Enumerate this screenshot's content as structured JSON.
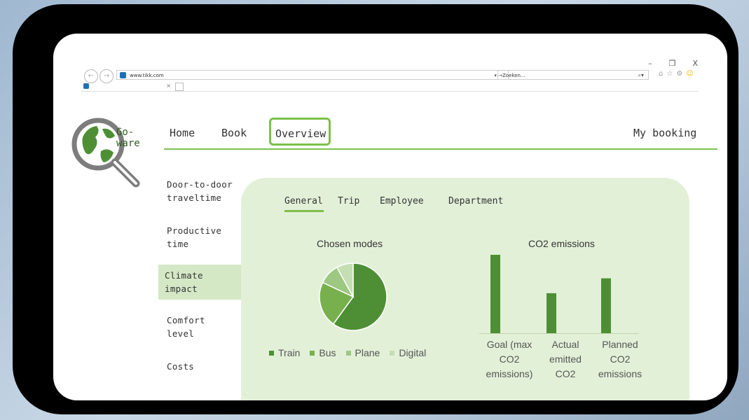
{
  "browser": {
    "url": "www.tikk.com",
    "search_placeholder": "Zoeken...",
    "tab_title": "",
    "window_controls": [
      "–",
      "❐",
      "X"
    ]
  },
  "app": {
    "logo_text": "Go-\nware",
    "nav": {
      "home": "Home",
      "book": "Book",
      "overview": "Overview",
      "my_booking": "My booking"
    },
    "sidebar": [
      {
        "label": "Door-to-door\ntraveltime"
      },
      {
        "label": "Productive\ntime"
      },
      {
        "label": "Climate\nimpact"
      },
      {
        "label": "Comfort\nlevel"
      },
      {
        "label": "Costs"
      }
    ],
    "subtabs": [
      "General",
      "Trip",
      "Employee",
      "Department"
    ]
  },
  "colors": {
    "accent_green": "#7cc04a",
    "panel_bg": "#e3f0d8",
    "train": "#4e8f35",
    "bus": "#78b04e",
    "plane": "#9dc882",
    "digital": "#c4dfb3"
  },
  "chart_data": [
    {
      "type": "pie",
      "title": "Chosen modes",
      "categories": [
        "Train",
        "Bus",
        "Plane",
        "Digital"
      ],
      "values": [
        60,
        22,
        10,
        8
      ],
      "legend": "bottom"
    },
    {
      "type": "bar",
      "title": "CO2 emissions",
      "categories": [
        "Goal (max\nCO2\nemissions)",
        "Actual\nemitted\nCO2",
        "Planned\nCO2\nemissions"
      ],
      "values": [
        100,
        51,
        70
      ],
      "ylim": [
        0,
        100
      ],
      "grid": false
    }
  ]
}
